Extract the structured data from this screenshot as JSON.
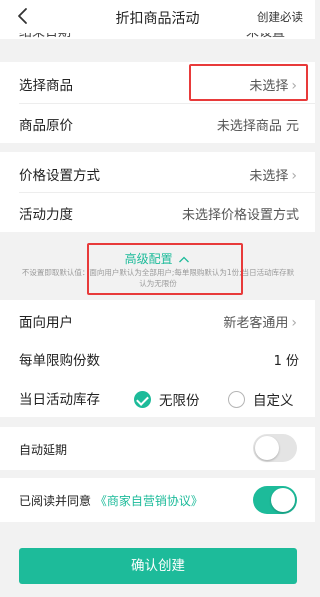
{
  "header": {
    "title": "折扣商品活动",
    "right_action": "创建必读"
  },
  "partial_row": {
    "label": "结束日期",
    "value": "未设置"
  },
  "product_section": {
    "select_label": "选择商品",
    "select_value": "未选择",
    "price_label": "商品原价",
    "price_value": "未选择商品 元"
  },
  "price_section": {
    "method_label": "价格设置方式",
    "method_value": "未选择",
    "strength_label": "活动力度",
    "strength_value": "未选择价格设置方式"
  },
  "advanced": {
    "title": "高级配置",
    "note": "不设置即取默认值：面向用户默认为全部用户;每单限购默认为1份;当日活动库存默认为无限份"
  },
  "settings": {
    "audience_label": "面向用户",
    "audience_value": "新老客通用",
    "limit_label": "每单限购份数",
    "limit_value": "1 份",
    "stock_label": "当日活动库存",
    "stock_option_unlimited": "无限份",
    "stock_option_custom": "自定义",
    "stock_selected": "无限份"
  },
  "auto_extend": {
    "label": "自动延期",
    "enabled": false
  },
  "agreement": {
    "prefix": "已阅读并同意",
    "link": "《商家自营销协议》",
    "checked": true
  },
  "confirm_button": "确认创建",
  "colors": {
    "accent": "#1dbb9a",
    "highlight": "#e83a3a",
    "background": "#f2f2f2"
  }
}
